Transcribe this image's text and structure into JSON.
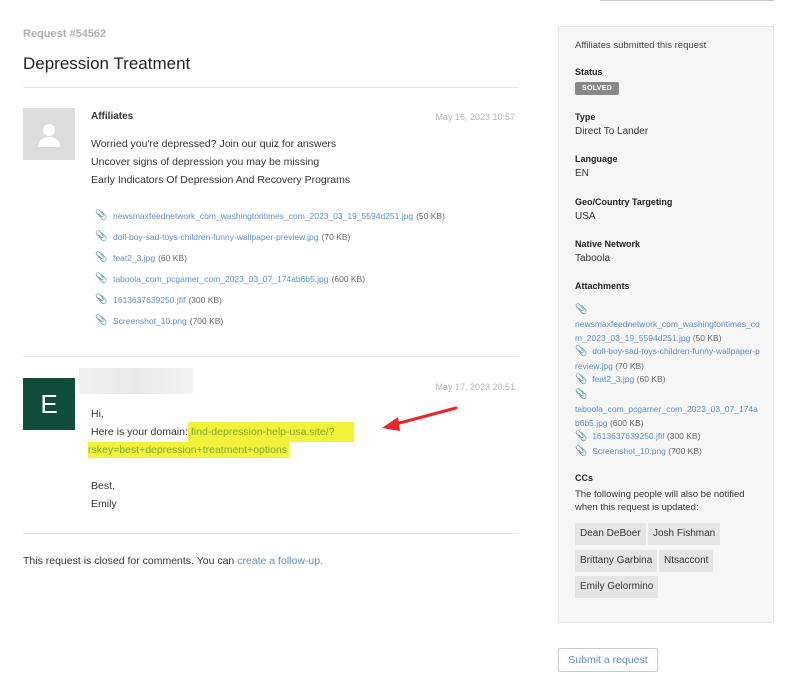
{
  "request": {
    "number": "Request #54562",
    "title": "Depression Treatment"
  },
  "comments": [
    {
      "author": "Affiliates",
      "date": "May 16, 2023 10:57",
      "lines": [
        "Worried you're depressed? Join our quiz for answers",
        "Uncover signs of depression you may be missing",
        "Early Indicators Of Depression And Recovery Programs"
      ],
      "attachments": [
        {
          "name": "newsmaxfeednetwork_com_washingtontimes_com_2023_03_19_5594d251.jpg",
          "size": "(50 KB)"
        },
        {
          "name": "doll-boy-sad-toys-children-funny-wallpaper-preview.jpg",
          "size": "(70 KB)"
        },
        {
          "name": "feat2_3.jpg",
          "size": "(60 KB)"
        },
        {
          "name": "taboola_com_pcgamer_com_2023_03_07_174ab6b5.jpg",
          "size": "(600 KB)"
        },
        {
          "name": "1613637639250.jfif",
          "size": "(300 KB)"
        },
        {
          "name": "Screenshot_10.png",
          "size": "(700 KB)"
        }
      ]
    },
    {
      "avatar_letter": "E",
      "date": "May 17, 2023 20:51",
      "greeting": "Hi,",
      "domain_prefix": "Here is your domain:",
      "domain_link_1": "find-depression-help-usa.site/?",
      "domain_link_2": "rskey=best+depression+treatment+options",
      "signoff": "Best,",
      "signature": "Emily"
    }
  ],
  "closed_notice": {
    "text": "This request is closed for comments. You can ",
    "link": "create a follow-up."
  },
  "sidebar": {
    "header": "Affiliates submitted this request",
    "status_label": "Status",
    "status_value": "SOLVED",
    "type_label": "Type",
    "type_value": "Direct To Lander",
    "language_label": "Language",
    "language_value": "EN",
    "geo_label": "Geo/Country Targeting",
    "geo_value": "USA",
    "network_label": "Native Network",
    "network_value": "Taboola",
    "attachments_label": "Attachments",
    "attachments": [
      {
        "name": "newsmaxfeednetwork_com_washingtontimes_com_2023_03_19_5594d251.jpg",
        "size": "(50 KB)"
      },
      {
        "name": "doll-boy-sad-toys-children-funny-wallpaper-preview.jpg",
        "size": "(70 KB)"
      },
      {
        "name": "feat2_3.jpg",
        "size": "(60 KB)"
      },
      {
        "name": "taboola_com_pcgamer_com_2023_03_07_174ab6b5.jpg",
        "size": "(600 KB)"
      },
      {
        "name": "1613637639250.jfif",
        "size": "(300 KB)"
      },
      {
        "name": "Screenshot_10.png",
        "size": "(700 KB)"
      }
    ],
    "ccs_label": "CCs",
    "ccs_description": "The following people will also be notified when this request is updated:",
    "ccs": [
      "Dean DeBoer",
      "Josh Fishman",
      "Brittany Garbina",
      "Ntsaccont",
      "Emily Gelormino"
    ]
  },
  "submit_label": "Submit a request",
  "icons": {
    "attachment": "paperclip-icon",
    "avatar_placeholder": "user-silhouette-icon",
    "annotation": "red-arrow"
  },
  "colors": {
    "link": "#5d8ec4",
    "highlight": "#f2f23a",
    "avatar_e": "#104d3b",
    "badge": "#888888"
  }
}
